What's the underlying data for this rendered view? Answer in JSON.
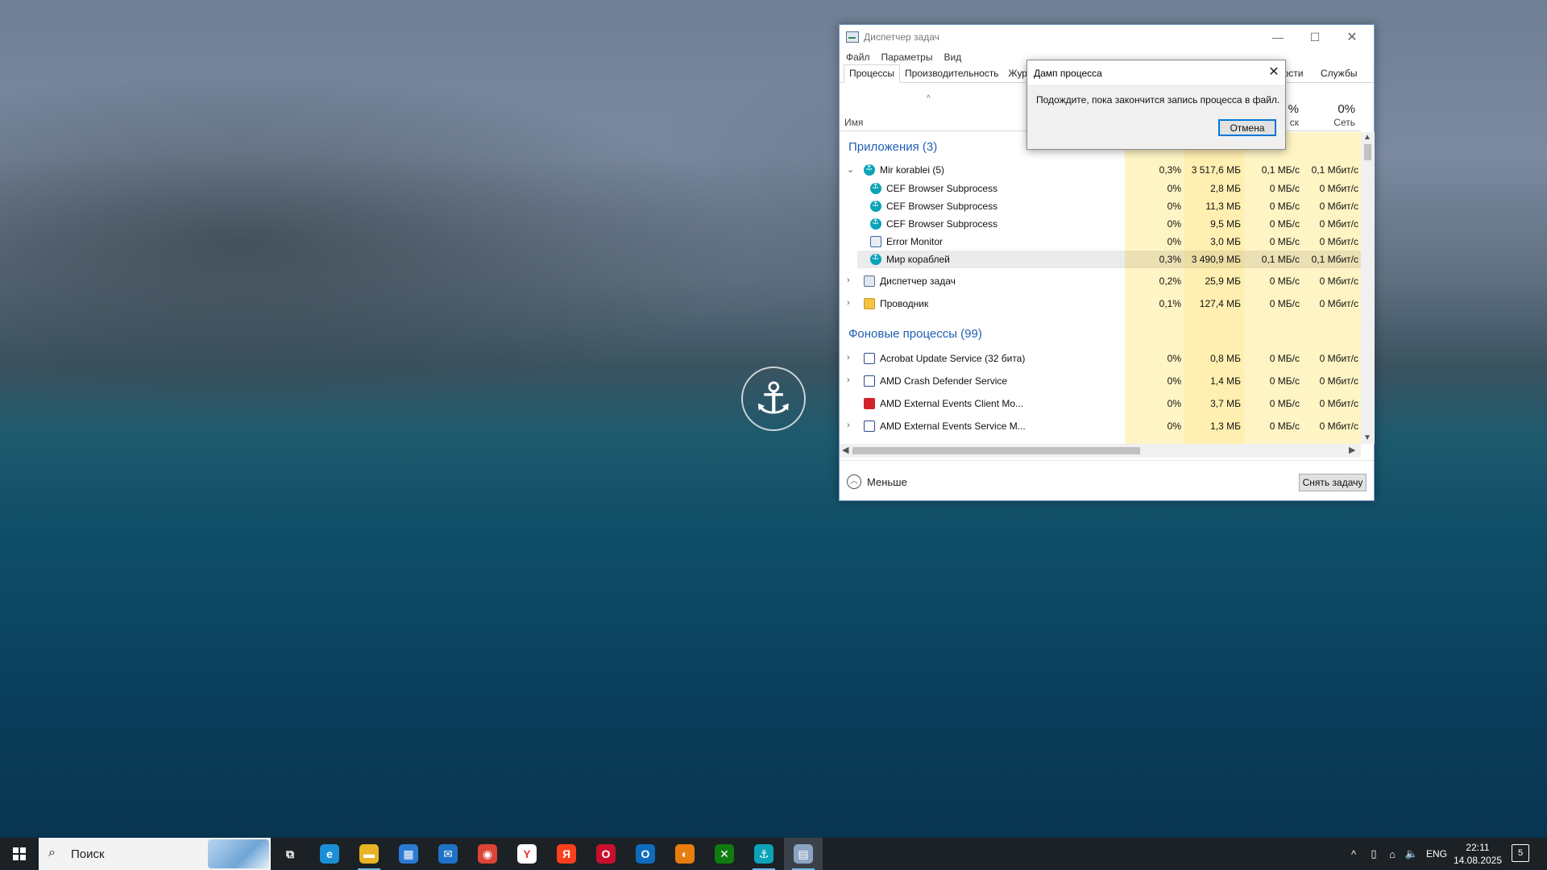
{
  "task_manager": {
    "title": "Диспетчер задач",
    "window_controls": {
      "minimize": "—",
      "maximize": "☐",
      "close": "✕"
    },
    "menu": [
      "Файл",
      "Параметры",
      "Вид"
    ],
    "tabs": [
      "Процессы",
      "Производительность",
      "Журн"
    ],
    "tabs_right": [
      "ности",
      "Службы"
    ],
    "columns": {
      "sort_indicator": "^",
      "name": "Имя",
      "disk_pct": "%",
      "disk_label": "ск",
      "net_pct": "0%",
      "net_label": "Сеть"
    },
    "groups": {
      "apps": "Приложения (3)",
      "background": "Фоновые процессы (99)"
    },
    "rows": [
      {
        "expander": "⌄",
        "icon": "wows-icon",
        "name": "Mir korablei (5)",
        "cpu": "0,3%",
        "mem": "3 517,6 МБ",
        "disk": "0,1 МБ/с",
        "net": "0,1 Мбит/с"
      },
      {
        "expander": "",
        "icon": "wows-icon",
        "name": "CEF Browser Subprocess",
        "cpu": "0%",
        "mem": "2,8 МБ",
        "disk": "0 МБ/с",
        "net": "0 Мбит/с"
      },
      {
        "expander": "",
        "icon": "wows-icon",
        "name": "CEF Browser Subprocess",
        "cpu": "0%",
        "mem": "11,3 МБ",
        "disk": "0 МБ/с",
        "net": "0 Мбит/с"
      },
      {
        "expander": "",
        "icon": "wows-icon",
        "name": "CEF Browser Subprocess",
        "cpu": "0%",
        "mem": "9,5 МБ",
        "disk": "0 МБ/с",
        "net": "0 Мбит/с"
      },
      {
        "expander": "",
        "icon": "monitor-icon",
        "name": "Error Monitor",
        "cpu": "0%",
        "mem": "3,0 МБ",
        "disk": "0 МБ/с",
        "net": "0 Мбит/с"
      },
      {
        "expander": "",
        "icon": "wows-icon",
        "name": "Мир кораблей",
        "cpu": "0,3%",
        "mem": "3 490,9 МБ",
        "disk": "0,1 МБ/с",
        "net": "0,1 Мбит/с"
      },
      {
        "expander": "›",
        "icon": "task-manager-icon",
        "name": "Диспетчер задач",
        "cpu": "0,2%",
        "mem": "25,9 МБ",
        "disk": "0 МБ/с",
        "net": "0 Мбит/с"
      },
      {
        "expander": "›",
        "icon": "folder-icon",
        "name": "Проводник",
        "cpu": "0,1%",
        "mem": "127,4 МБ",
        "disk": "0 МБ/с",
        "net": "0 Мбит/с"
      },
      {
        "expander": "›",
        "icon": "window-icon",
        "name": "Acrobat Update Service (32 бита)",
        "cpu": "0%",
        "mem": "0,8 МБ",
        "disk": "0 МБ/с",
        "net": "0 Мбит/с"
      },
      {
        "expander": "›",
        "icon": "service-icon",
        "name": "AMD Crash Defender Service",
        "cpu": "0%",
        "mem": "1,4 МБ",
        "disk": "0 МБ/с",
        "net": "0 Мбит/с"
      },
      {
        "expander": "",
        "icon": "amd-icon",
        "name": "AMD External Events Client Mo...",
        "cpu": "0%",
        "mem": "3,7 МБ",
        "disk": "0 МБ/с",
        "net": "0 Мбит/с"
      },
      {
        "expander": "›",
        "icon": "service-icon",
        "name": "AMD External Events Service M...",
        "cpu": "0%",
        "mem": "1,3 МБ",
        "disk": "0 МБ/с",
        "net": "0 Мбит/с"
      }
    ],
    "footer": {
      "less_label": "Меньше",
      "end_task": "Снять задачу"
    }
  },
  "dialog": {
    "title": "Дамп процесса",
    "message": "Подождите, пока закончится запись процесса в файл.",
    "cancel": "Отмена",
    "close": "✕"
  },
  "taskbar": {
    "search_placeholder": "Поиск",
    "apps": [
      {
        "name": "task-view-icon",
        "glyph": "⧉",
        "color": "#1c2126"
      },
      {
        "name": "edge-icon",
        "glyph": "e",
        "color": "#1a8fd6"
      },
      {
        "name": "file-explorer-icon",
        "glyph": "▬",
        "color": "#e8b425"
      },
      {
        "name": "store-icon",
        "glyph": "▦",
        "color": "#2b7bd3"
      },
      {
        "name": "mail-icon",
        "glyph": "✉",
        "color": "#1e73c8"
      },
      {
        "name": "chrome-icon",
        "glyph": "◉",
        "color": "#db4437"
      },
      {
        "name": "yandex-browser-icon",
        "glyph": "Y",
        "color": "#ffffff"
      },
      {
        "name": "yandex-icon",
        "glyph": "Я",
        "color": "#fc3f1d"
      },
      {
        "name": "opera-icon",
        "glyph": "O",
        "color": "#c8102e"
      },
      {
        "name": "outlook-icon",
        "glyph": "O",
        "color": "#0f6cbd"
      },
      {
        "name": "blender-icon",
        "glyph": "◐",
        "color": "#e87d0d"
      },
      {
        "name": "xbox-icon",
        "glyph": "✕",
        "color": "#107c10"
      },
      {
        "name": "wows-launcher-icon",
        "glyph": "⚓",
        "color": "#0aa3b8"
      },
      {
        "name": "task-manager-taskbar-icon",
        "glyph": "▤",
        "color": "#8aa4c2"
      }
    ],
    "tray": {
      "chevron": "^",
      "lang": "ENG"
    },
    "time": "22:11",
    "date": "14.08.2025",
    "notifications": "5"
  }
}
